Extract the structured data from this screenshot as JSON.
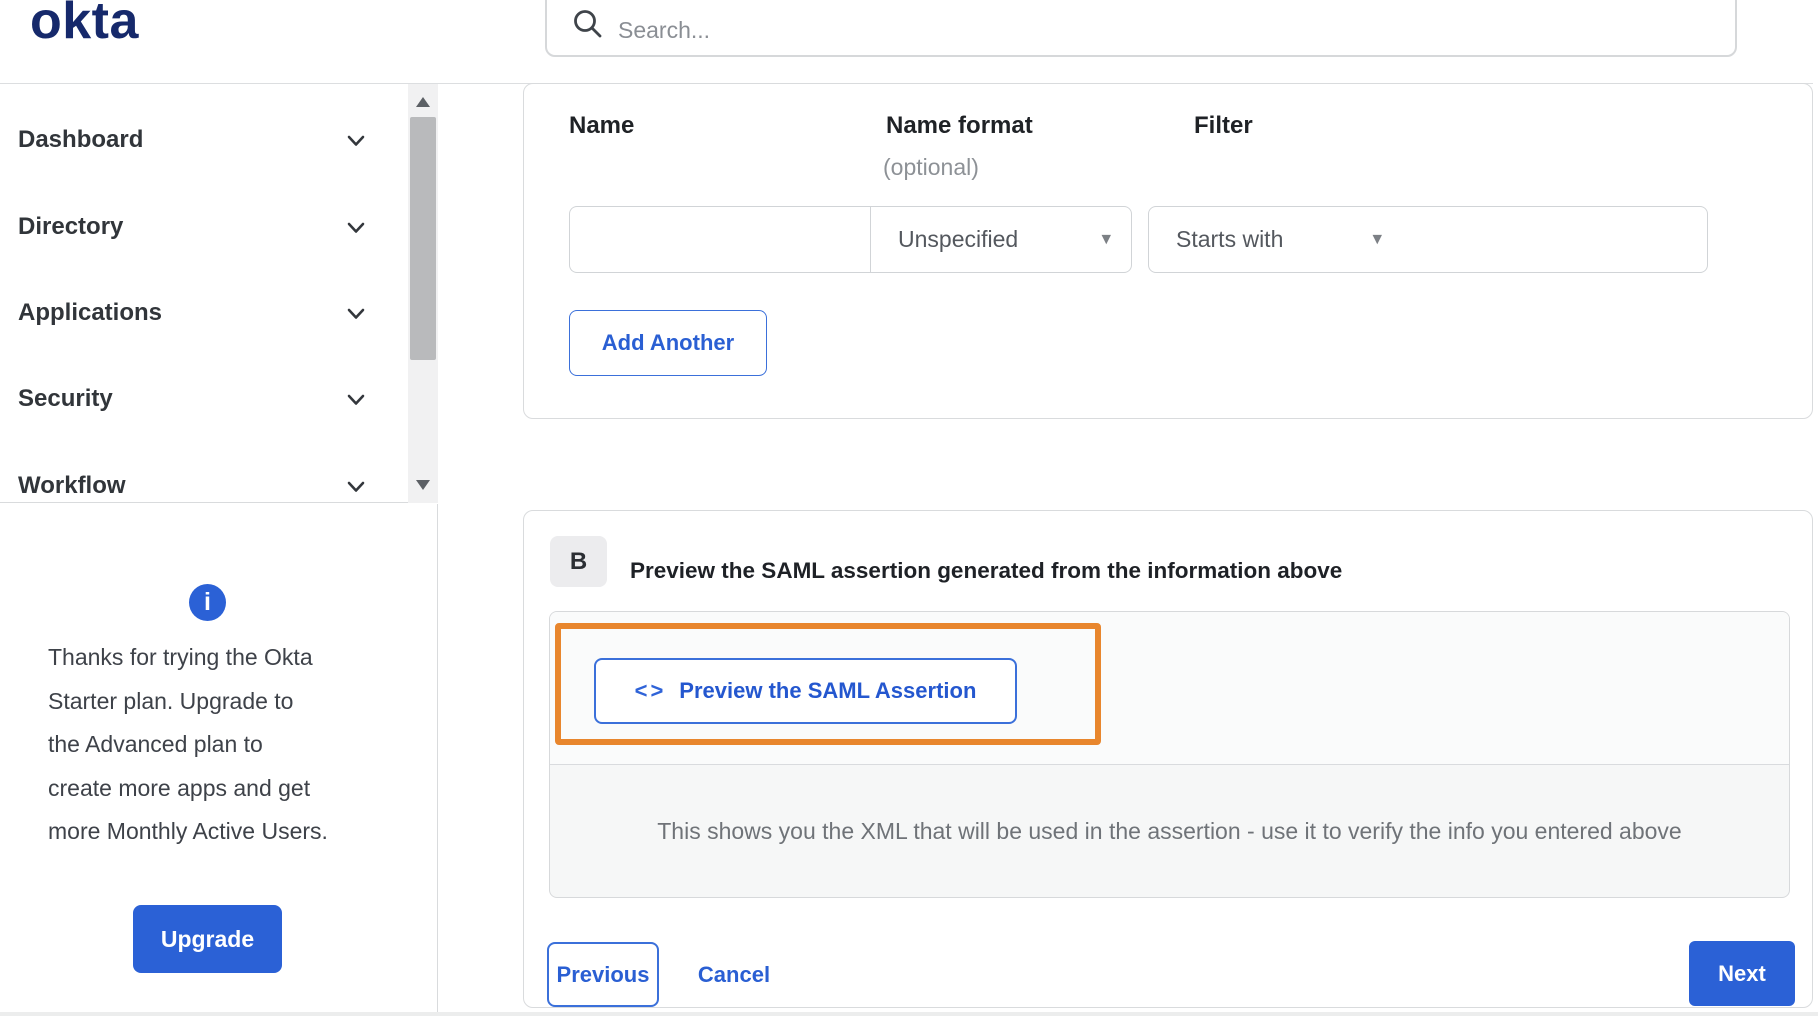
{
  "brand": {
    "logo_text": "okta"
  },
  "search": {
    "placeholder": "Search..."
  },
  "sidebar": {
    "items": [
      {
        "label": "Dashboard"
      },
      {
        "label": "Directory"
      },
      {
        "label": "Applications"
      },
      {
        "label": "Security"
      },
      {
        "label": "Workflow"
      }
    ],
    "upgrade_panel": {
      "info_glyph": "i",
      "lines": [
        "Thanks for trying the Okta",
        "Starter plan. Upgrade to",
        "the Advanced plan to",
        "create more apps and get",
        "more Monthly Active Users."
      ],
      "button_label": "Upgrade"
    }
  },
  "attribute_form": {
    "name_label": "Name",
    "name_format_label": "Name format",
    "name_format_optional": "(optional)",
    "filter_label": "Filter",
    "name_value": "",
    "name_format_value": "Unspecified",
    "filter_operator_value": "Starts with",
    "filter_value": "",
    "caret_glyph": "▾",
    "add_another_label": "Add Another"
  },
  "section_b": {
    "badge": "B",
    "title": "Preview the SAML assertion generated from the information above",
    "preview_button": {
      "code_glyph": "<>",
      "label": "Preview the SAML Assertion"
    },
    "hint": "This shows you the XML that will be used in the assertion - use it to verify the info you entered above"
  },
  "footer": {
    "previous_label": "Previous",
    "cancel_label": "Cancel",
    "next_label": "Next"
  },
  "colors": {
    "accent_blue": "#2b61d6",
    "link_blue": "#2a5fd3",
    "annotation_orange": "#e8862d",
    "logo_navy": "#16296b"
  }
}
